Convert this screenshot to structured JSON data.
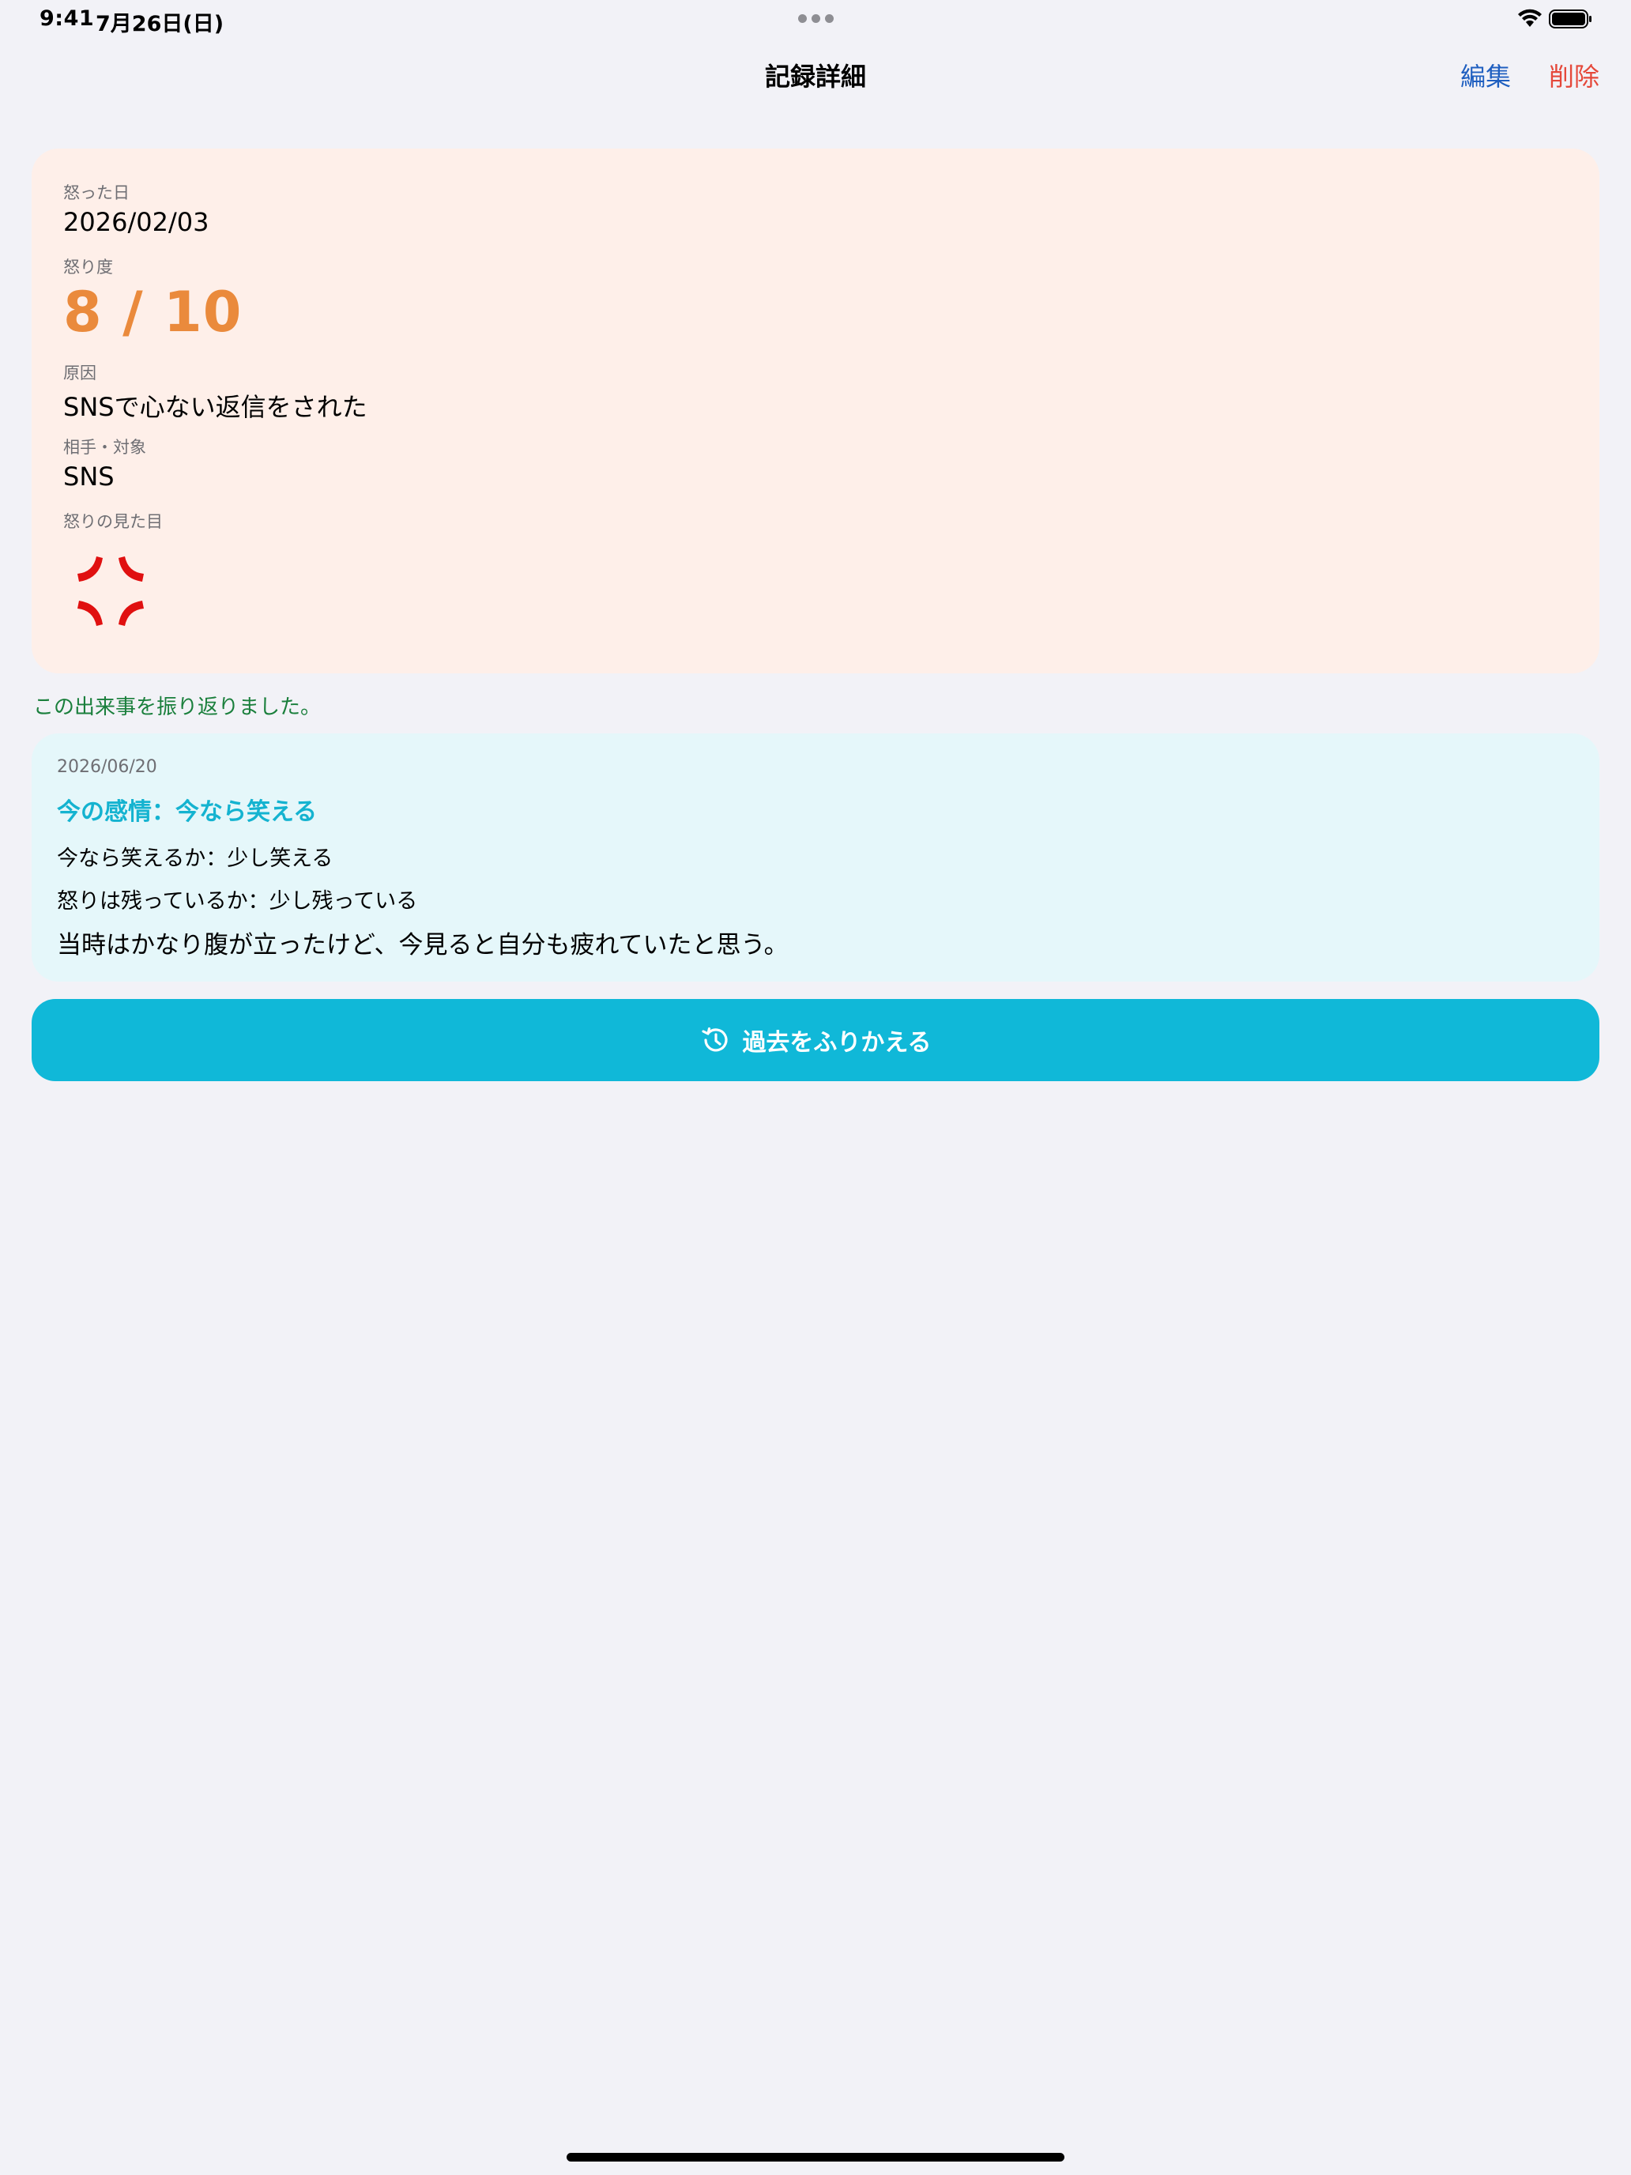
{
  "status_bar": {
    "time": "9:41",
    "date": "7月26日(日)"
  },
  "nav": {
    "title": "記録詳細",
    "edit_label": "編集",
    "delete_label": "削除"
  },
  "record": {
    "date_label": "怒った日",
    "date_value": "2026/02/03",
    "anger_label": "怒り度",
    "anger_value": "8 / 10",
    "cause_label": "原因",
    "cause_value": "SNSで心ない返信をされた",
    "target_label": "相手・対象",
    "target_value": "SNS",
    "appearance_label": "怒りの見た目",
    "appearance_icon": "anger-symbol-icon"
  },
  "reflected_note": "この出来事を振り返りました。",
  "reflection": {
    "date": "2026/06/20",
    "emotion": "今の感情：今なら笑える",
    "laugh_line": "今なら笑えるか：少し笑える",
    "remaining_line": "怒りは残っているか：少し残っている",
    "comment": "当時はかなり腹が立ったけど、今見ると自分も疲れていたと思う。"
  },
  "button": {
    "label": "過去をふりかえる",
    "icon": "history-icon"
  },
  "colors": {
    "accent": "#10b8d8",
    "anger": "#ea8a3c",
    "record_card_bg": "#feefe9",
    "reflection_card_bg": "#e5f7fa",
    "delete": "#e5483a",
    "edit": "#1f5fc0",
    "reflected_note": "#1a7f3c"
  }
}
